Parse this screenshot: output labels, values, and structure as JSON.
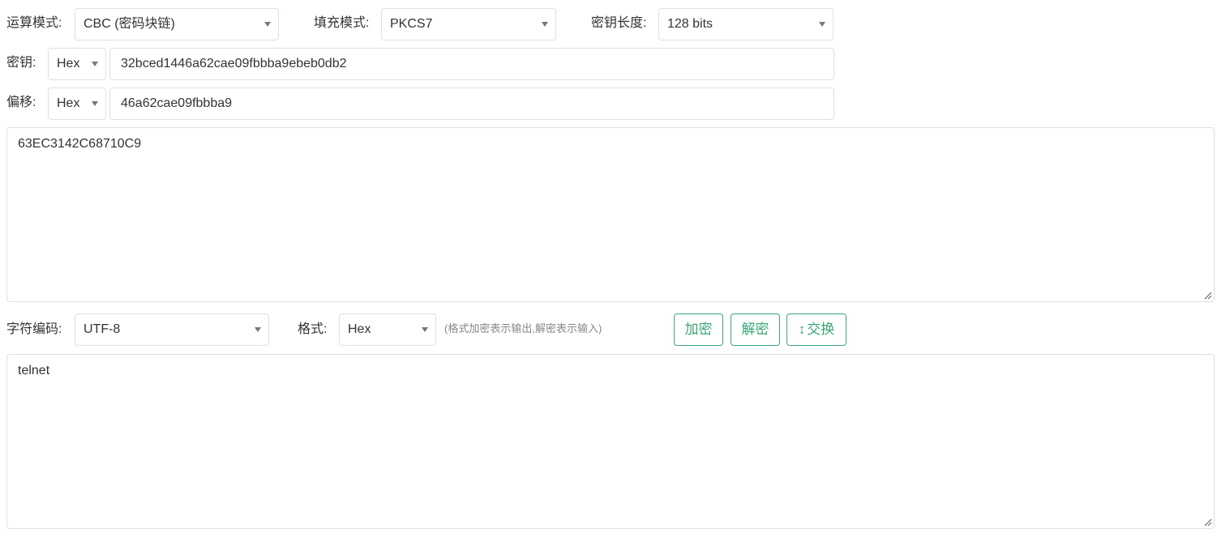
{
  "row1": {
    "mode_label": "运算模式:",
    "mode_value": "CBC (密码块链)",
    "padding_label": "填充模式:",
    "padding_value": "PKCS7",
    "keylen_label": "密钥长度:",
    "keylen_value": "128 bits"
  },
  "key": {
    "label": "密钥:",
    "format": "Hex",
    "value": "32bced1446a62cae09fbbba9ebeb0db2"
  },
  "iv": {
    "label": "偏移:",
    "format": "Hex",
    "value": "46a62cae09fbbba9"
  },
  "ciphertext": {
    "value": "63EC3142C68710C9"
  },
  "row2": {
    "charset_label": "字符编码:",
    "charset_value": "UTF-8",
    "format_label": "格式:",
    "format_value": "Hex",
    "hint": "(格式加密表示输出,解密表示输入)",
    "encrypt_label": "加密",
    "decrypt_label": "解密",
    "swap_arrow": "↕",
    "swap_label": "交换"
  },
  "plaintext": {
    "value": "telnet"
  },
  "colors": {
    "accent": "#3aa676",
    "border": "#dcdfe6",
    "text": "#333333",
    "hint": "#888888"
  },
  "icons": {
    "dropdown": "caret-down-icon",
    "resize": "resize-grip-icon",
    "swap": "up-down-arrow-icon"
  }
}
